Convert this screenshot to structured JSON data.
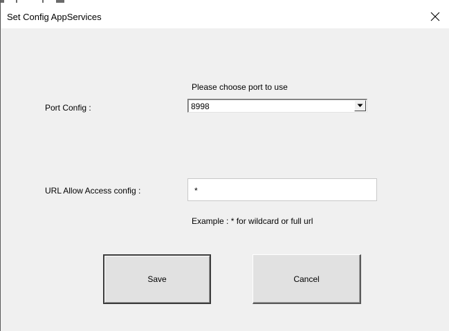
{
  "window": {
    "title": "Set Config AppServices"
  },
  "icons": {
    "close": "close-icon",
    "combo_arrow": "chevron-down-icon"
  },
  "port": {
    "hint": "Please choose port to use",
    "label": "Port Config :",
    "selected": "8998"
  },
  "url": {
    "label": "URL Allow Access config :",
    "value": "*",
    "example": "Example : * for wildcard or full url"
  },
  "buttons": {
    "save": "Save",
    "cancel": "Cancel"
  },
  "colors": {
    "dialog_background": "#f0f0f0",
    "titlebar_background": "#ffffff",
    "button_face": "#e1e1e1"
  }
}
